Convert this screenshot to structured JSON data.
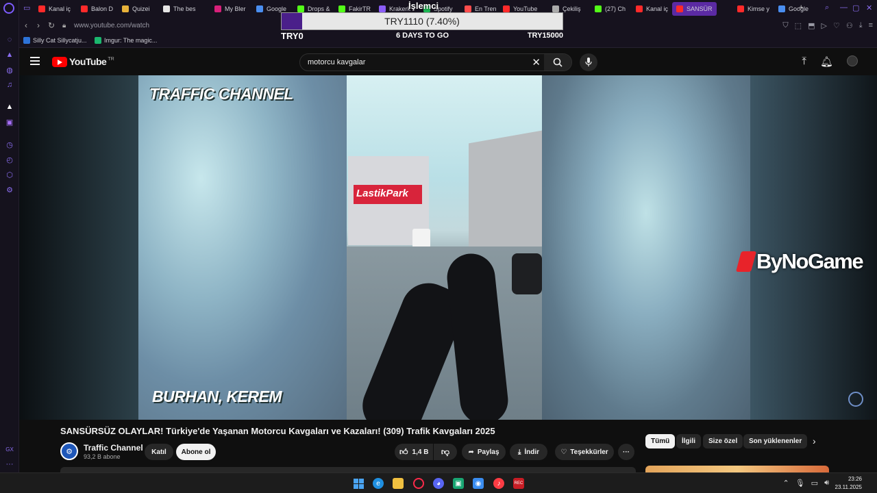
{
  "browser": {
    "tabs": [
      {
        "label": "Kanal iç",
        "color": "#ff2a2a"
      },
      {
        "label": "Balon D",
        "color": "#ff2a2a"
      },
      {
        "label": "Quizei",
        "color": "#e7b23a"
      },
      {
        "label": "The bes",
        "color": "#e6e6e6"
      },
      {
        "label": "My Bler",
        "color": "#d8207a"
      },
      {
        "label": "Google",
        "color": "#4a8ef0"
      },
      {
        "label": "Drops &",
        "color": "#53fc18"
      },
      {
        "label": "FakirTR",
        "color": "#53fc18"
      },
      {
        "label": "Krakerk",
        "color": "#8a5cf6"
      },
      {
        "label": "Spotify",
        "color": "#1db954"
      },
      {
        "label": "En Tren",
        "color": "#ff4d4d"
      },
      {
        "label": "YouTube",
        "color": "#ff2a2a"
      },
      {
        "label": "Çekiliş",
        "color": "#aaaaaa"
      },
      {
        "label": "(27) Ch",
        "color": "#53fc18"
      },
      {
        "label": "Kanal iç",
        "color": "#ff2a2a"
      },
      {
        "label": "SANSÜRSÜ",
        "color": "#ff2a2a",
        "active": true
      },
      {
        "label": "Kimse y",
        "color": "#ff2a2a"
      },
      {
        "label": "Google",
        "color": "#4a8ef0"
      }
    ],
    "url": "www.youtube.com/watch",
    "bookmarks": [
      {
        "label": "Silly Cat Sillycatju...",
        "color": "#2d73d8"
      },
      {
        "label": "Imgur: The magic...",
        "color": "#1bb76e"
      }
    ]
  },
  "donation": {
    "title": "İşlemci",
    "amount": "TRY1110 (7.40%)",
    "progress": 0.074,
    "min_label": "TRY0",
    "days_label": "6 DAYS TO GO",
    "max_label": "TRY15000",
    "fill_color": "#4a1f8a"
  },
  "youtube": {
    "logo_text": "YouTube",
    "logo_region": "TR",
    "search_query": "motorcu kavgalar",
    "video": {
      "caption_top": "TRAFFIC CHANNEL",
      "caption_bottom": "BURHAN, KEREM",
      "sign_text": "LastikPark",
      "overlay_brand": "ByNoGame"
    },
    "title": "SANSÜRSÜZ OLAYLAR! Türkiye'de Yaşanan Motorcu Kavgaları ve Kazaları! (309) Trafik Kavgaları 2025",
    "channel": {
      "name": "Traffic Channel",
      "subs": "93,2 B abone"
    },
    "buttons": {
      "join": "Katıl",
      "subscribe": "Abone ol",
      "likes": "1,4 B",
      "share": "Paylaş",
      "download": "İndir",
      "thanks": "Teşekkürler"
    },
    "chips": [
      "Tümü",
      "İlgili",
      "Size özel",
      "Son yüklenenler"
    ]
  },
  "taskbar": {
    "time": "23:26",
    "date": "23.11.2025"
  }
}
